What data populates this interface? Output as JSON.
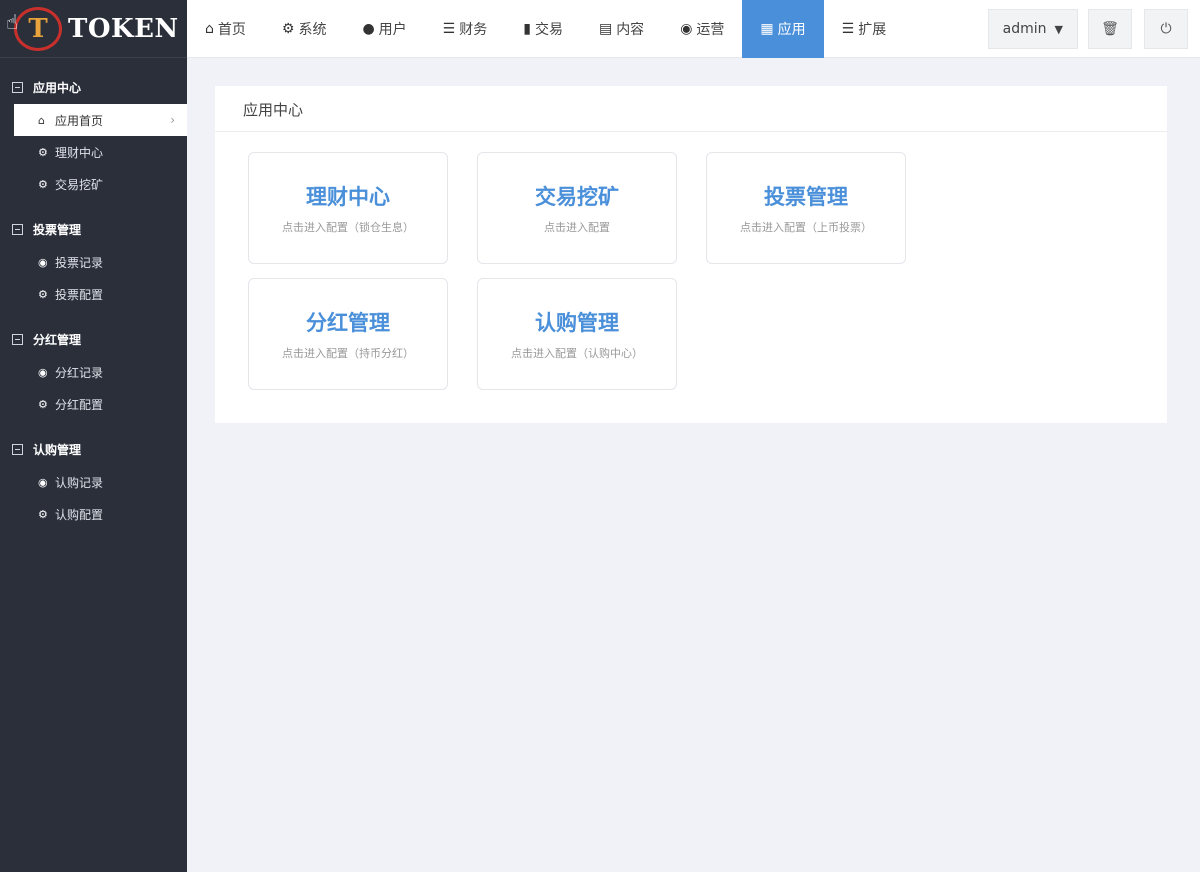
{
  "app": {
    "logo_letter": "T",
    "logo_text": "TOKEN"
  },
  "sidebar": {
    "groups": [
      {
        "title": "应用中心",
        "items": [
          {
            "label": "应用首页",
            "icon": "home-icon"
          },
          {
            "label": "理财中心",
            "icon": "gear-icon"
          },
          {
            "label": "交易挖矿",
            "icon": "gear-icon"
          }
        ]
      },
      {
        "title": "投票管理",
        "items": [
          {
            "label": "投票记录",
            "icon": "globe-icon"
          },
          {
            "label": "投票配置",
            "icon": "gear-icon"
          }
        ]
      },
      {
        "title": "分红管理",
        "items": [
          {
            "label": "分红记录",
            "icon": "globe-icon"
          },
          {
            "label": "分红配置",
            "icon": "gear-icon"
          }
        ]
      },
      {
        "title": "认购管理",
        "items": [
          {
            "label": "认购记录",
            "icon": "globe-icon"
          },
          {
            "label": "认购配置",
            "icon": "gear-icon"
          }
        ]
      }
    ]
  },
  "topnav": {
    "items": [
      {
        "label": "首页",
        "icon": "home-icon"
      },
      {
        "label": "系统",
        "icon": "gear-icon"
      },
      {
        "label": "用户",
        "icon": "user-icon"
      },
      {
        "label": "财务",
        "icon": "list-icon"
      },
      {
        "label": "交易",
        "icon": "bar-chart-icon"
      },
      {
        "label": "内容",
        "icon": "content-icon"
      },
      {
        "label": "运营",
        "icon": "globe-icon"
      },
      {
        "label": "应用",
        "icon": "grid-icon"
      },
      {
        "label": "扩展",
        "icon": "server-icon"
      }
    ],
    "active": "应用",
    "admin_label": "admin"
  },
  "main": {
    "title": "应用中心",
    "cards": [
      {
        "title": "理财中心",
        "sub": "点击进入配置（锁仓生息）"
      },
      {
        "title": "交易挖矿",
        "sub": "点击进入配置"
      },
      {
        "title": "投票管理",
        "sub": "点击进入配置（上币投票）"
      },
      {
        "title": "分红管理",
        "sub": "点击进入配置（持币分红）"
      },
      {
        "title": "认购管理",
        "sub": "点击进入配置（认购中心）"
      }
    ]
  },
  "colors": {
    "sidebar_bg": "#2a2f3a",
    "accent": "#4a8fd9",
    "page_bg": "#f1f2f7"
  }
}
